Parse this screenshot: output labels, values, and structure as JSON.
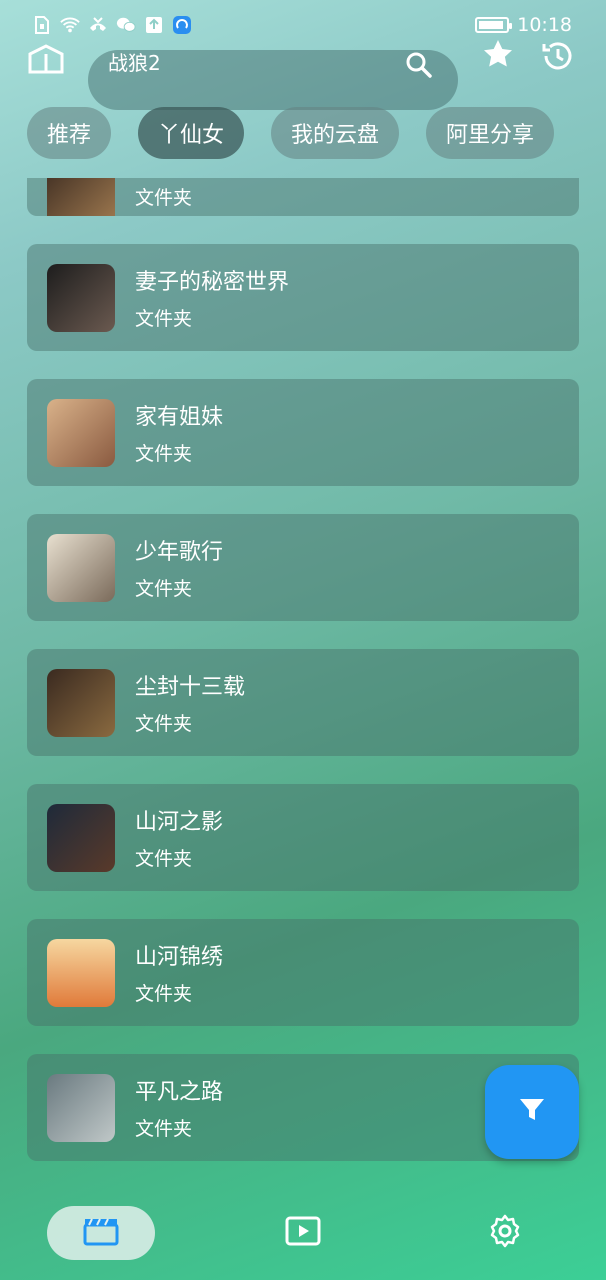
{
  "status_bar": {
    "time": "10:18",
    "left_icons": [
      "sim-icon",
      "wifi-icon",
      "call-icon",
      "wechat-icon",
      "upload-icon",
      "app-icon"
    ]
  },
  "search": {
    "value": "战狼2"
  },
  "tabs": [
    {
      "label": "推荐",
      "active": false
    },
    {
      "label": "丫仙女",
      "active": true
    },
    {
      "label": "我的云盘",
      "active": false
    },
    {
      "label": "阿里分享",
      "active": false
    }
  ],
  "list": {
    "partial_item_subtitle": "文件夹",
    "items": [
      {
        "title": "妻子的秘密世界",
        "subtitle": "文件夹",
        "thumb_colors": [
          "#2b2b2b",
          "#6b5a50"
        ]
      },
      {
        "title": "家有姐妹",
        "subtitle": "文件夹",
        "thumb_colors": [
          "#d9b28a",
          "#8a5a40"
        ]
      },
      {
        "title": "少年歌行",
        "subtitle": "文件夹",
        "thumb_colors": [
          "#e8e0d0",
          "#7a6a5a"
        ]
      },
      {
        "title": "尘封十三载",
        "subtitle": "文件夹",
        "thumb_colors": [
          "#3a2a20",
          "#8a6a40"
        ]
      },
      {
        "title": "山河之影",
        "subtitle": "文件夹",
        "thumb_colors": [
          "#1e2a3a",
          "#5a3a2a"
        ]
      },
      {
        "title": "山河锦绣",
        "subtitle": "文件夹",
        "thumb_colors": [
          "#f2c27a",
          "#e07a3a"
        ]
      },
      {
        "title": "平凡之路",
        "subtitle": "文件夹",
        "thumb_colors": [
          "#6a7a80",
          "#c0c8c8"
        ]
      }
    ]
  },
  "fab": {
    "icon": "filter-icon",
    "color": "#2196f3"
  },
  "bottom_nav": [
    {
      "name": "movies",
      "icon": "clapperboard-icon",
      "active": true
    },
    {
      "name": "player",
      "icon": "play-icon",
      "active": false
    },
    {
      "name": "settings",
      "icon": "gear-icon",
      "active": false
    }
  ]
}
